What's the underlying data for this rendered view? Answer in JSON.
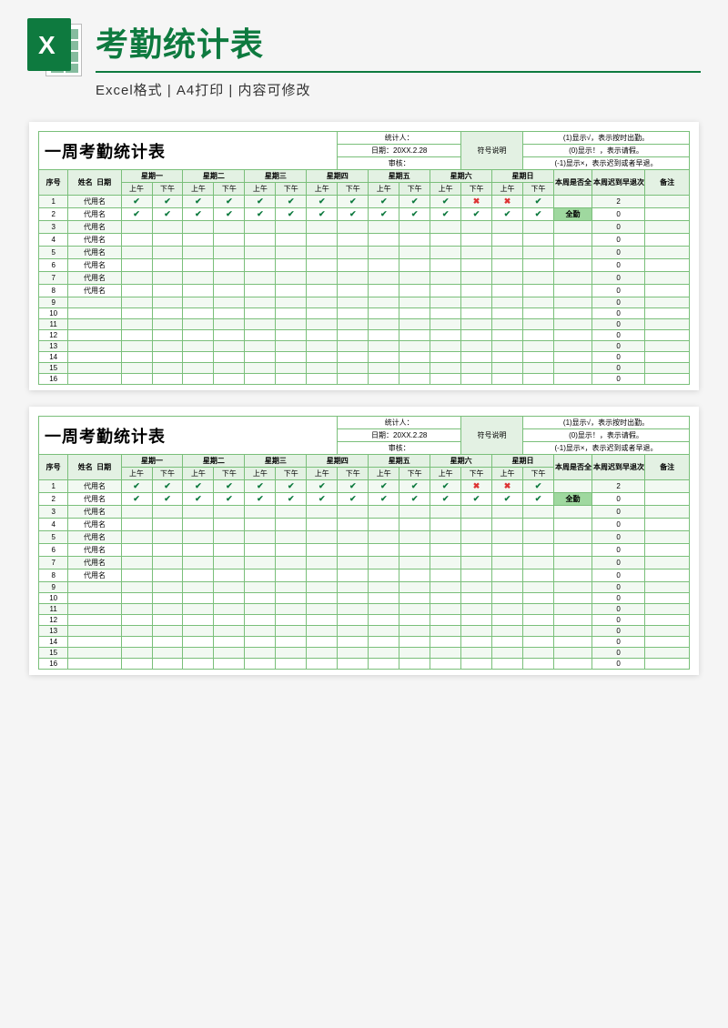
{
  "header": {
    "title": "考勤统计表",
    "subtitle": "Excel格式 | A4打印 | 内容可修改",
    "x_letter": "X"
  },
  "sheet": {
    "title": "一周考勤统计表",
    "meta": {
      "stat_label": "统计人：",
      "date_label": "日期：20XX.2.28",
      "audit_label": "审核：",
      "legend_title": "符号说明"
    },
    "legend": [
      "(1)显示√，表示按时出勤。",
      "(0)显示！，表示请假。",
      "(-1)显示×，表示迟到或者早退。"
    ],
    "cols": {
      "seq": "序号",
      "name_date": "姓名",
      "date_hdr": "日期",
      "days": [
        "星期一",
        "星期二",
        "星期三",
        "星期四",
        "星期五",
        "星期六",
        "星期日"
      ],
      "ampm": [
        "上午",
        "下午"
      ],
      "full": "本周是否全勤",
      "late": "本周迟到早退次数",
      "remark": "备注"
    },
    "full_label": "全勤",
    "rows": [
      {
        "seq": 1,
        "name": "代用名",
        "marks": [
          "c",
          "c",
          "c",
          "c",
          "c",
          "c",
          "c",
          "c",
          "c",
          "c",
          "c",
          "x",
          "x",
          "c"
        ],
        "full": "",
        "late": "2"
      },
      {
        "seq": 2,
        "name": "代用名",
        "marks": [
          "c",
          "c",
          "c",
          "c",
          "c",
          "c",
          "c",
          "c",
          "c",
          "c",
          "c",
          "c",
          "c",
          "c"
        ],
        "full": "full",
        "late": "0"
      },
      {
        "seq": 3,
        "name": "代用名",
        "marks": [],
        "full": "",
        "late": "0"
      },
      {
        "seq": 4,
        "name": "代用名",
        "marks": [],
        "full": "",
        "late": "0"
      },
      {
        "seq": 5,
        "name": "代用名",
        "marks": [],
        "full": "",
        "late": "0"
      },
      {
        "seq": 6,
        "name": "代用名",
        "marks": [],
        "full": "",
        "late": "0"
      },
      {
        "seq": 7,
        "name": "代用名",
        "marks": [],
        "full": "",
        "late": "0"
      },
      {
        "seq": 8,
        "name": "代用名",
        "marks": [],
        "full": "",
        "late": "0"
      },
      {
        "seq": 9,
        "name": "",
        "marks": [],
        "full": "",
        "late": "0"
      },
      {
        "seq": 10,
        "name": "",
        "marks": [],
        "full": "",
        "late": "0"
      },
      {
        "seq": 11,
        "name": "",
        "marks": [],
        "full": "",
        "late": "0"
      },
      {
        "seq": 12,
        "name": "",
        "marks": [],
        "full": "",
        "late": "0"
      },
      {
        "seq": 13,
        "name": "",
        "marks": [],
        "full": "",
        "late": "0"
      },
      {
        "seq": 14,
        "name": "",
        "marks": [],
        "full": "",
        "late": "0"
      },
      {
        "seq": 15,
        "name": "",
        "marks": [],
        "full": "",
        "late": "0"
      },
      {
        "seq": 16,
        "name": "",
        "marks": [],
        "full": "",
        "late": "0"
      }
    ]
  }
}
